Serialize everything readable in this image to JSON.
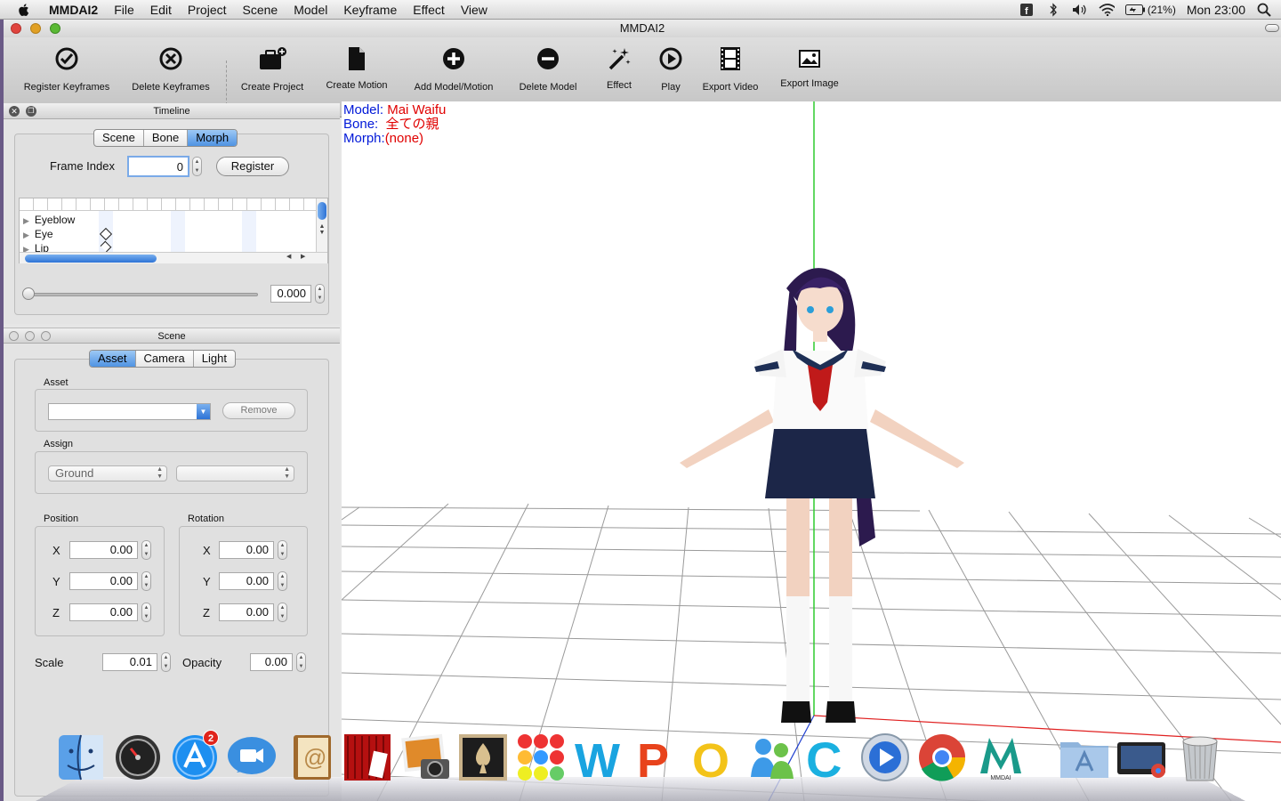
{
  "menubar": {
    "app_name": "MMDAI2",
    "items": [
      "File",
      "Edit",
      "Project",
      "Scene",
      "Model",
      "Keyframe",
      "Effect",
      "View"
    ],
    "battery": "(21%)",
    "clock": "Mon 23:00"
  },
  "window": {
    "title": "MMDAI2"
  },
  "toolbar": {
    "register_keyframes": "Register Keyframes",
    "delete_keyframes": "Delete Keyframes",
    "create_project": "Create Project",
    "create_motion": "Create Motion",
    "add_model_motion": "Add Model/Motion",
    "delete_model": "Delete Model",
    "effect": "Effect",
    "play": "Play",
    "export_video": "Export Video",
    "export_image": "Export Image"
  },
  "timeline": {
    "title": "Timeline",
    "tabs": [
      "Scene",
      "Bone",
      "Morph"
    ],
    "selected_tab": "Morph",
    "frame_index_label": "Frame Index",
    "frame_index_value": "0",
    "register_label": "Register",
    "tracks": [
      "Eyeblow",
      "Eye",
      "Lip"
    ],
    "slider_value": "0.000"
  },
  "scene": {
    "title": "Scene",
    "tabs": [
      "Asset",
      "Camera",
      "Light"
    ],
    "selected_tab": "Asset",
    "asset_label": "Asset",
    "remove_label": "Remove",
    "assign_label": "Assign",
    "assign_value": "Ground",
    "position_label": "Position",
    "rotation_label": "Rotation",
    "axis_labels": [
      "X",
      "Y",
      "Z"
    ],
    "position_values": [
      "0.00",
      "0.00",
      "0.00"
    ],
    "rotation_values": [
      "0.00",
      "0.00",
      "0.00"
    ],
    "scale_label": "Scale",
    "scale_value": "0.01",
    "opacity_label": "Opacity",
    "opacity_value": "0.00"
  },
  "viewport": {
    "model_key": "Model:",
    "model_value": "Mai Waifu",
    "bone_key": "Bone:",
    "bone_value": "全ての親",
    "morph_key": "Morph:",
    "morph_value": "(none)",
    "label_color": "#0018d8",
    "value_color": "#e00000"
  },
  "dock": {
    "icons": [
      "finder",
      "dashboard",
      "app-store",
      "facetime",
      "address-book",
      "photo-booth",
      "iphoto",
      "solitaire",
      "game",
      "word",
      "powerpoint",
      "outlook",
      "lync",
      "chrome-c",
      "quicktime",
      "chrome",
      "mmdai",
      "applications-folder",
      "downloads-stack",
      "trash"
    ],
    "app_store_badge": "2",
    "mmdai_caption": "MMDAI"
  }
}
